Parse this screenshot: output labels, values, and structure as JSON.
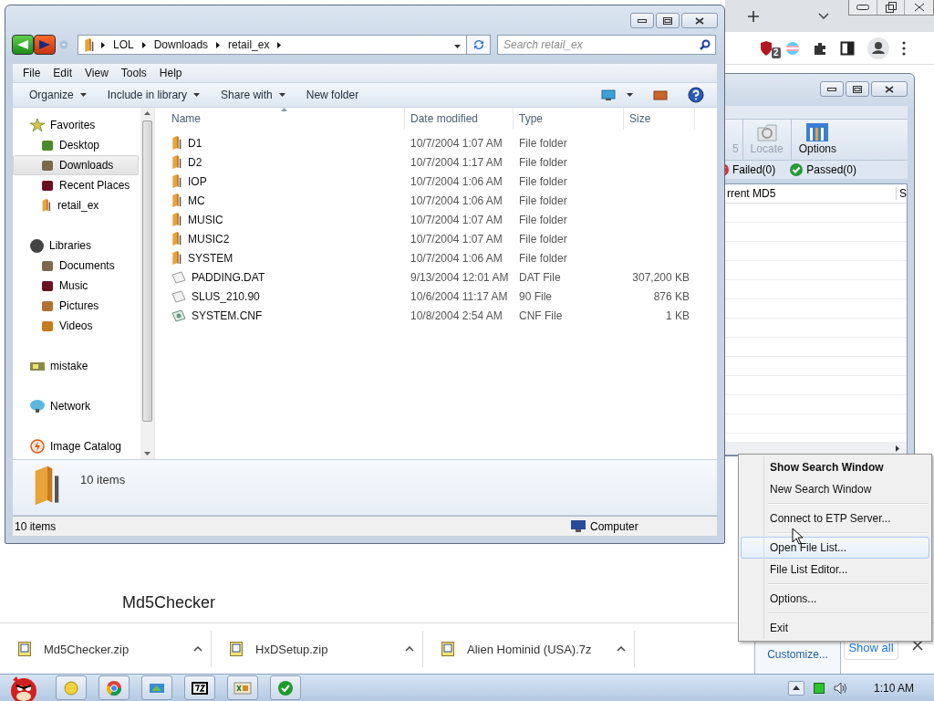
{
  "browser": {
    "extension_badge": "2",
    "page_heading": "Md5Checker",
    "downloads": [
      {
        "name": "Md5Checker.zip"
      },
      {
        "name": "HxDSetup.zip"
      },
      {
        "name": "Alien Hominid (USA).7z"
      }
    ],
    "show_all": "Show all"
  },
  "md5_window": {
    "toolbar": [
      {
        "label": "5",
        "disabled": true
      },
      {
        "label": "Locate",
        "disabled": true
      },
      {
        "label": "Options",
        "disabled": false
      }
    ],
    "filters": [
      {
        "label": "Failed(0)",
        "kind": "failed"
      },
      {
        "label": "Passed(0)",
        "kind": "passed"
      }
    ],
    "columns": [
      "rrent MD5",
      "S"
    ]
  },
  "explorer": {
    "breadcrumb": [
      "LOL",
      "Downloads",
      "retail_ex"
    ],
    "search": {
      "placeholder": "Search retail_ex"
    },
    "menu": [
      "File",
      "Edit",
      "View",
      "Tools",
      "Help"
    ],
    "commands": [
      {
        "label": "Organize",
        "dropdown": true
      },
      {
        "label": "Include in library",
        "dropdown": true
      },
      {
        "label": "Share with",
        "dropdown": true
      },
      {
        "label": "New folder",
        "dropdown": false
      }
    ],
    "nav": [
      {
        "label": "Favorites",
        "selected": false,
        "children": [
          {
            "label": "Desktop",
            "selected": false
          },
          {
            "label": "Downloads",
            "selected": true
          },
          {
            "label": "Recent Places",
            "selected": false
          },
          {
            "label": "retail_ex",
            "selected": false
          }
        ]
      },
      {
        "label": "Libraries",
        "selected": false,
        "children": [
          {
            "label": "Documents",
            "selected": false
          },
          {
            "label": "Music",
            "selected": false
          },
          {
            "label": "Pictures",
            "selected": false
          },
          {
            "label": "Videos",
            "selected": false
          }
        ]
      },
      {
        "label": "mistake",
        "selected": false
      },
      {
        "label": "Network",
        "selected": false
      },
      {
        "label": "Image Catalog",
        "selected": false
      }
    ],
    "columns": [
      "Name",
      "Date modified",
      "Type",
      "Size"
    ],
    "rows": [
      {
        "name": "D1",
        "date": "10/7/2004 1:07 AM",
        "type": "File folder",
        "kind": "folder",
        "selected": false
      },
      {
        "name": "D2",
        "date": "10/7/2004 1:17 AM",
        "type": "File folder",
        "kind": "folder",
        "selected": false
      },
      {
        "name": "IOP",
        "date": "10/7/2004 1:06 AM",
        "type": "File folder",
        "kind": "folder",
        "selected": false
      },
      {
        "name": "MC",
        "date": "10/7/2004 1:06 AM",
        "type": "File folder",
        "kind": "folder",
        "selected": false
      },
      {
        "name": "MUSIC",
        "date": "10/7/2004 1:07 AM",
        "type": "File folder",
        "kind": "folder",
        "selected": false
      },
      {
        "name": "MUSIC2",
        "date": "10/7/2004 1:07 AM",
        "type": "File folder",
        "kind": "folder",
        "selected": false
      },
      {
        "name": "SYSTEM",
        "date": "10/7/2004 1:06 AM",
        "type": "File folder",
        "kind": "folder",
        "selected": false
      },
      {
        "name": "PADDING.DAT",
        "date": "9/13/2004 12:01 AM",
        "type": "DAT File",
        "size": "307,200 KB",
        "kind": "file",
        "selected": false
      },
      {
        "name": "SLUS_210.90",
        "date": "10/6/2004 11:17 AM",
        "type": "90 File",
        "size": "876 KB",
        "kind": "file",
        "selected": false
      },
      {
        "name": "SYSTEM.CNF",
        "date": "10/8/2004 2:54 AM",
        "type": "CNF File",
        "size": "1 KB",
        "kind": "config",
        "selected": false
      }
    ],
    "details": "10 items",
    "status": "10 items",
    "status_location": "Computer"
  },
  "context_menu": {
    "groups": [
      {
        "items": [
          {
            "label": "Show Search Window",
            "bold": true,
            "selected": false
          },
          {
            "label": "New Search Window",
            "bold": false,
            "selected": false
          }
        ]
      },
      {
        "items": [
          {
            "label": "Connect to ETP Server...",
            "bold": false,
            "selected": false
          }
        ]
      },
      {
        "items": [
          {
            "label": "Open File List...",
            "bold": false,
            "selected": true
          },
          {
            "label": "File List Editor...",
            "bold": false,
            "selected": false
          }
        ]
      },
      {
        "items": [
          {
            "label": "Options...",
            "bold": false,
            "selected": false
          }
        ]
      },
      {
        "items": [
          {
            "label": "Exit",
            "bold": false,
            "selected": false
          }
        ]
      }
    ]
  },
  "tray_popup": {
    "label": "Customize..."
  },
  "taskbar": {
    "clock": "1:10 AM"
  }
}
